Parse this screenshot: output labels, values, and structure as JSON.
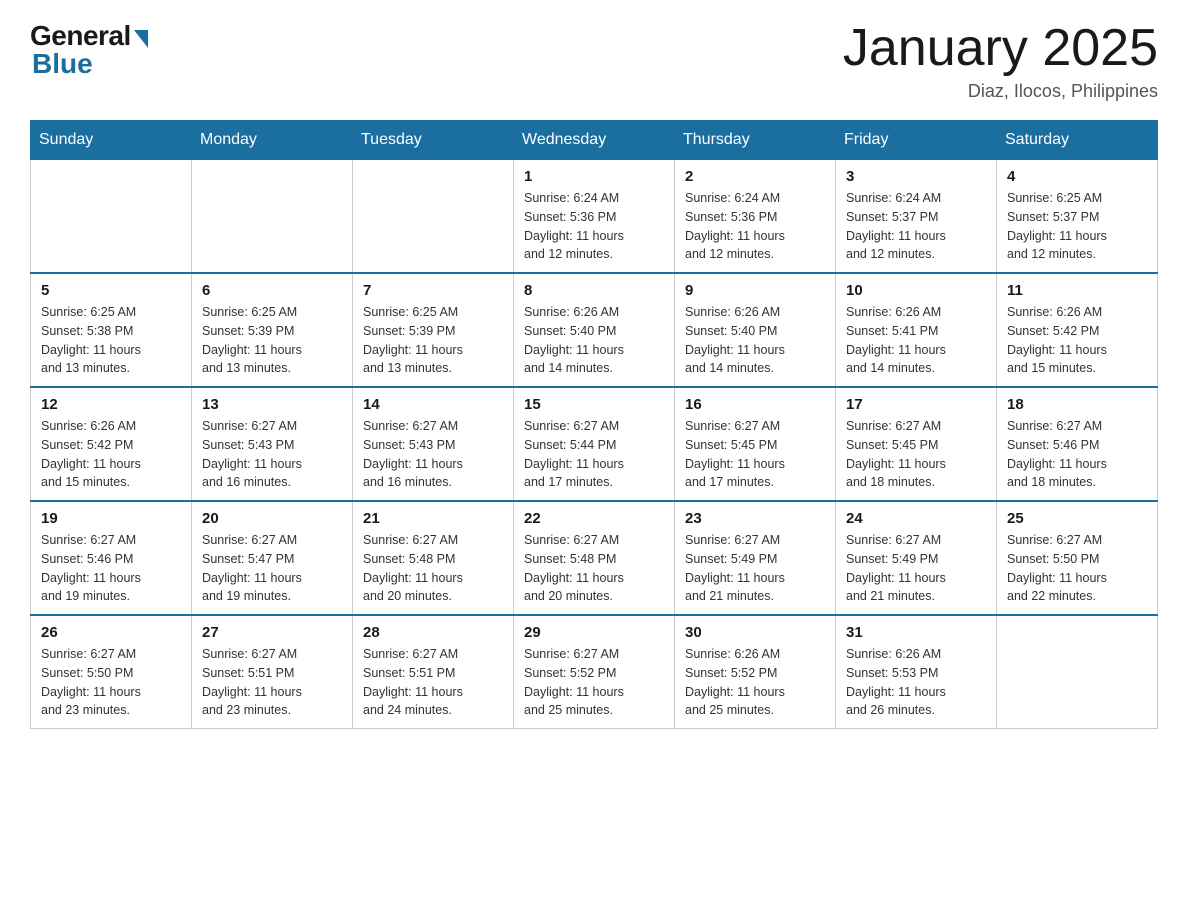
{
  "header": {
    "logo_general": "General",
    "logo_blue": "Blue",
    "month_title": "January 2025",
    "location": "Diaz, Ilocos, Philippines"
  },
  "days_of_week": [
    "Sunday",
    "Monday",
    "Tuesday",
    "Wednesday",
    "Thursday",
    "Friday",
    "Saturday"
  ],
  "weeks": [
    [
      {
        "day": "",
        "info": ""
      },
      {
        "day": "",
        "info": ""
      },
      {
        "day": "",
        "info": ""
      },
      {
        "day": "1",
        "info": "Sunrise: 6:24 AM\nSunset: 5:36 PM\nDaylight: 11 hours\nand 12 minutes."
      },
      {
        "day": "2",
        "info": "Sunrise: 6:24 AM\nSunset: 5:36 PM\nDaylight: 11 hours\nand 12 minutes."
      },
      {
        "day": "3",
        "info": "Sunrise: 6:24 AM\nSunset: 5:37 PM\nDaylight: 11 hours\nand 12 minutes."
      },
      {
        "day": "4",
        "info": "Sunrise: 6:25 AM\nSunset: 5:37 PM\nDaylight: 11 hours\nand 12 minutes."
      }
    ],
    [
      {
        "day": "5",
        "info": "Sunrise: 6:25 AM\nSunset: 5:38 PM\nDaylight: 11 hours\nand 13 minutes."
      },
      {
        "day": "6",
        "info": "Sunrise: 6:25 AM\nSunset: 5:39 PM\nDaylight: 11 hours\nand 13 minutes."
      },
      {
        "day": "7",
        "info": "Sunrise: 6:25 AM\nSunset: 5:39 PM\nDaylight: 11 hours\nand 13 minutes."
      },
      {
        "day": "8",
        "info": "Sunrise: 6:26 AM\nSunset: 5:40 PM\nDaylight: 11 hours\nand 14 minutes."
      },
      {
        "day": "9",
        "info": "Sunrise: 6:26 AM\nSunset: 5:40 PM\nDaylight: 11 hours\nand 14 minutes."
      },
      {
        "day": "10",
        "info": "Sunrise: 6:26 AM\nSunset: 5:41 PM\nDaylight: 11 hours\nand 14 minutes."
      },
      {
        "day": "11",
        "info": "Sunrise: 6:26 AM\nSunset: 5:42 PM\nDaylight: 11 hours\nand 15 minutes."
      }
    ],
    [
      {
        "day": "12",
        "info": "Sunrise: 6:26 AM\nSunset: 5:42 PM\nDaylight: 11 hours\nand 15 minutes."
      },
      {
        "day": "13",
        "info": "Sunrise: 6:27 AM\nSunset: 5:43 PM\nDaylight: 11 hours\nand 16 minutes."
      },
      {
        "day": "14",
        "info": "Sunrise: 6:27 AM\nSunset: 5:43 PM\nDaylight: 11 hours\nand 16 minutes."
      },
      {
        "day": "15",
        "info": "Sunrise: 6:27 AM\nSunset: 5:44 PM\nDaylight: 11 hours\nand 17 minutes."
      },
      {
        "day": "16",
        "info": "Sunrise: 6:27 AM\nSunset: 5:45 PM\nDaylight: 11 hours\nand 17 minutes."
      },
      {
        "day": "17",
        "info": "Sunrise: 6:27 AM\nSunset: 5:45 PM\nDaylight: 11 hours\nand 18 minutes."
      },
      {
        "day": "18",
        "info": "Sunrise: 6:27 AM\nSunset: 5:46 PM\nDaylight: 11 hours\nand 18 minutes."
      }
    ],
    [
      {
        "day": "19",
        "info": "Sunrise: 6:27 AM\nSunset: 5:46 PM\nDaylight: 11 hours\nand 19 minutes."
      },
      {
        "day": "20",
        "info": "Sunrise: 6:27 AM\nSunset: 5:47 PM\nDaylight: 11 hours\nand 19 minutes."
      },
      {
        "day": "21",
        "info": "Sunrise: 6:27 AM\nSunset: 5:48 PM\nDaylight: 11 hours\nand 20 minutes."
      },
      {
        "day": "22",
        "info": "Sunrise: 6:27 AM\nSunset: 5:48 PM\nDaylight: 11 hours\nand 20 minutes."
      },
      {
        "day": "23",
        "info": "Sunrise: 6:27 AM\nSunset: 5:49 PM\nDaylight: 11 hours\nand 21 minutes."
      },
      {
        "day": "24",
        "info": "Sunrise: 6:27 AM\nSunset: 5:49 PM\nDaylight: 11 hours\nand 21 minutes."
      },
      {
        "day": "25",
        "info": "Sunrise: 6:27 AM\nSunset: 5:50 PM\nDaylight: 11 hours\nand 22 minutes."
      }
    ],
    [
      {
        "day": "26",
        "info": "Sunrise: 6:27 AM\nSunset: 5:50 PM\nDaylight: 11 hours\nand 23 minutes."
      },
      {
        "day": "27",
        "info": "Sunrise: 6:27 AM\nSunset: 5:51 PM\nDaylight: 11 hours\nand 23 minutes."
      },
      {
        "day": "28",
        "info": "Sunrise: 6:27 AM\nSunset: 5:51 PM\nDaylight: 11 hours\nand 24 minutes."
      },
      {
        "day": "29",
        "info": "Sunrise: 6:27 AM\nSunset: 5:52 PM\nDaylight: 11 hours\nand 25 minutes."
      },
      {
        "day": "30",
        "info": "Sunrise: 6:26 AM\nSunset: 5:52 PM\nDaylight: 11 hours\nand 25 minutes."
      },
      {
        "day": "31",
        "info": "Sunrise: 6:26 AM\nSunset: 5:53 PM\nDaylight: 11 hours\nand 26 minutes."
      },
      {
        "day": "",
        "info": ""
      }
    ]
  ]
}
